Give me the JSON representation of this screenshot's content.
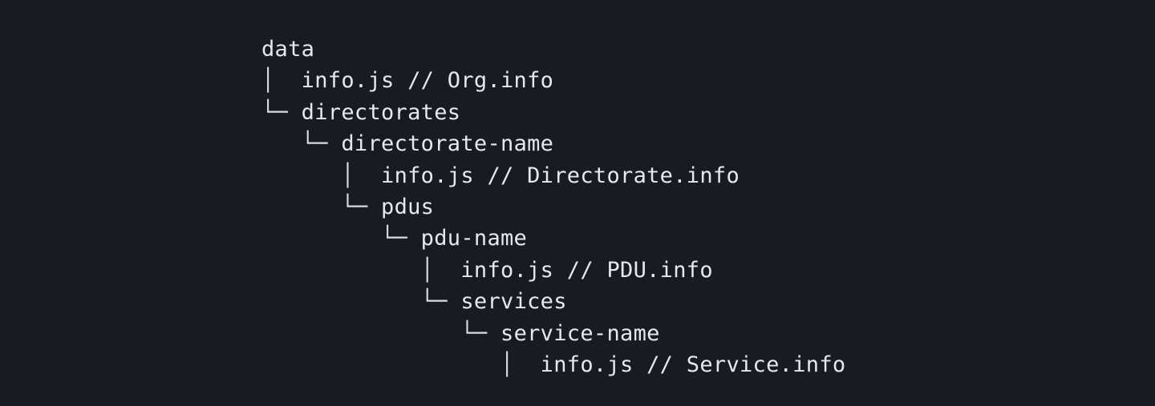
{
  "tree": {
    "lines": [
      {
        "indent": "",
        "connector": "",
        "text": "data"
      },
      {
        "indent": "",
        "connector": "│  ",
        "text": "info.js // Org.info"
      },
      {
        "indent": "",
        "connector": "└─ ",
        "text": "directorates"
      },
      {
        "indent": "   ",
        "connector": "└─ ",
        "text": "directorate-name"
      },
      {
        "indent": "      ",
        "connector": "│  ",
        "text": "info.js // Directorate.info"
      },
      {
        "indent": "      ",
        "connector": "└─ ",
        "text": "pdus"
      },
      {
        "indent": "         ",
        "connector": "└─ ",
        "text": "pdu-name"
      },
      {
        "indent": "            ",
        "connector": "│  ",
        "text": "info.js // PDU.info"
      },
      {
        "indent": "            ",
        "connector": "└─ ",
        "text": "services"
      },
      {
        "indent": "               ",
        "connector": "└─ ",
        "text": "service-name"
      },
      {
        "indent": "                  ",
        "connector": "│  ",
        "text": "info.js // Service.info"
      }
    ]
  }
}
